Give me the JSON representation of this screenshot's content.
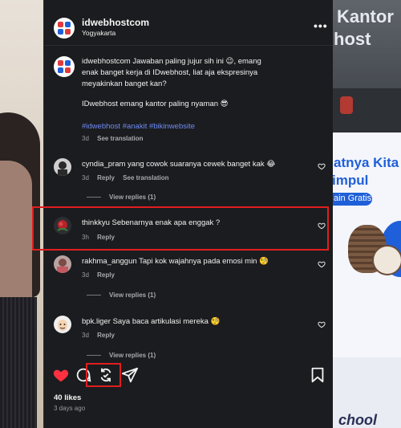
{
  "post": {
    "username": "idwebhostcom",
    "location": "Yogyakarta",
    "more_label": "•••"
  },
  "caption": {
    "text": "idwebhostcom Jawaban paling jujur sih ini 😉, emang enak banget kerja di IDwebhost, liat aja ekspresinya meyakinkan banget kan?",
    "text2": "IDwebhost emang kantor paling nyaman 😎",
    "hashtags": "#idwebhost #anakit #bikinwebsite",
    "time": "3d",
    "see_translation": "See translation"
  },
  "comments": [
    {
      "username": "cyndia_pram",
      "text": "yang cowok suaranya cewek banget kak 😂",
      "time": "3d",
      "reply_label": "Reply",
      "see_translation": "See translation",
      "view_replies": "View replies (1)"
    },
    {
      "username": "thinkkyu",
      "text": "Sebenarnya enak apa enggak ?",
      "time": "3h",
      "reply_label": "Reply"
    },
    {
      "username": "rakhma_anggun",
      "text": "Tapi kok wajahnya pada emosi min 🧐",
      "time": "3d",
      "reply_label": "Reply",
      "view_replies": "View replies (1)"
    },
    {
      "username": "bpk.liger",
      "text": "Saya baca artikulasi mereka 🧐",
      "time": "3d",
      "reply_label": "Reply",
      "view_replies": "View replies (1)"
    }
  ],
  "footer": {
    "likes": "40 likes",
    "date": "3 days ago"
  },
  "background": {
    "right_top_line1": "Kantor",
    "right_top_line2": "host",
    "right_promo_line1": "atnya Kita",
    "right_promo_line2": "impul",
    "right_promo_pill": "ain Gratis",
    "right_bottom": "chool"
  },
  "colors": {
    "panel_bg": "#1b1c1f",
    "like_red": "#ff3040",
    "hashtag_blue": "#6e8bf3",
    "highlight_red": "#e01e1e"
  },
  "icons": {
    "like": "heart-icon",
    "comment": "comment-icon",
    "repost": "repost-icon",
    "share": "send-icon",
    "save": "bookmark-icon"
  }
}
